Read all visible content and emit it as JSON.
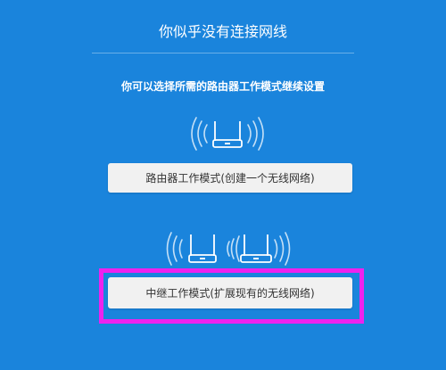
{
  "header": {
    "title": "你似乎没有连接网线",
    "subtitle": "你可以选择所需的路由器工作模式继续设置"
  },
  "modes": [
    {
      "label": "路由器工作模式(创建一个无线网络)",
      "icon": "router-icon"
    },
    {
      "label": "中继工作模式(扩展现有的无线网络)",
      "icon": "repeater-icon"
    }
  ],
  "colors": {
    "background": "#1a84dc",
    "button": "#f1f1f1",
    "highlight": "#ee22ee"
  }
}
